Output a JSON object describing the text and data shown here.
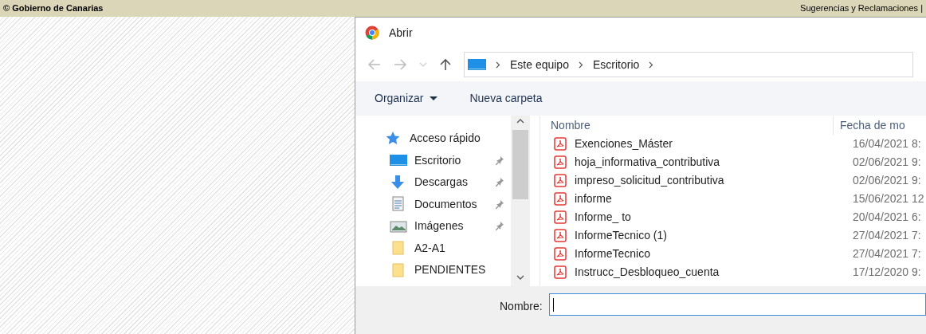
{
  "page_footer": {
    "copyright": "© Gobierno de Canarias",
    "links": "Sugerencias y Reclamaciones |"
  },
  "dialog": {
    "title": "Abrir",
    "address": {
      "path": [
        "Este equipo",
        "Escritorio"
      ]
    },
    "toolbar": {
      "organize": "Organizar",
      "new_folder": "Nueva carpeta"
    },
    "nav_items": [
      {
        "kind": "star",
        "label": "Acceso rápido",
        "pinned": false
      },
      {
        "kind": "desktop",
        "label": "Escritorio",
        "pinned": true
      },
      {
        "kind": "download",
        "label": "Descargas",
        "pinned": true
      },
      {
        "kind": "document",
        "label": "Documentos",
        "pinned": true
      },
      {
        "kind": "pictures",
        "label": "Imágenes",
        "pinned": true
      },
      {
        "kind": "folder",
        "label": "A2-A1",
        "pinned": false
      },
      {
        "kind": "folder",
        "label": "PENDIENTES",
        "pinned": false
      }
    ],
    "columns": [
      "Nombre",
      "Fecha de mo"
    ],
    "files": [
      {
        "name": "Exenciones_Máster",
        "date": "16/04/2021 8:"
      },
      {
        "name": "hoja_informativa_contributiva",
        "date": "02/06/2021 9:"
      },
      {
        "name": "impreso_solicitud_contributiva",
        "date": "02/06/2021 9:"
      },
      {
        "name": "informe",
        "date": "15/06/2021 12"
      },
      {
        "name": "Informe_ to",
        "date": "20/04/2021 6:"
      },
      {
        "name": "InformeTecnico (1)",
        "date": "27/04/2021 7:"
      },
      {
        "name": "InformeTecnico",
        "date": "27/04/2021 7:"
      },
      {
        "name": "Instrucc_Desbloqueo_cuenta",
        "date": "17/12/2020 9:"
      }
    ],
    "filename_label": "Nombre:"
  }
}
